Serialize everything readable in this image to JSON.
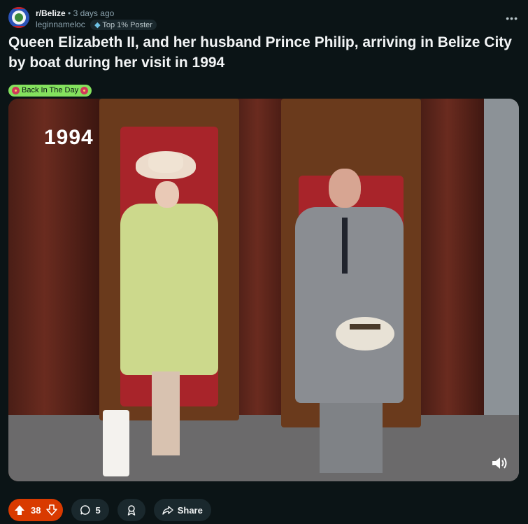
{
  "post": {
    "subreddit": "r/Belize",
    "separator": "•",
    "time_ago": "3 days ago",
    "username": "leginnameloc",
    "user_flair": "Top 1% Poster",
    "more_label": "•••",
    "title": "Queen Elizabeth II, and her husband Prince Philip, arriving in Belize City by boat during her visit in 1994",
    "post_flair": "Back In The Day"
  },
  "media": {
    "overlay_year": "1994",
    "sound_icon": "speaker-icon"
  },
  "actions": {
    "upvotes": "38",
    "comments": "5",
    "share_label": "Share"
  },
  "colors": {
    "background": "#0b1416",
    "upvote_active": "#d93a00",
    "flair_green": "#84e25e",
    "pill_bg": "#1a282d"
  }
}
